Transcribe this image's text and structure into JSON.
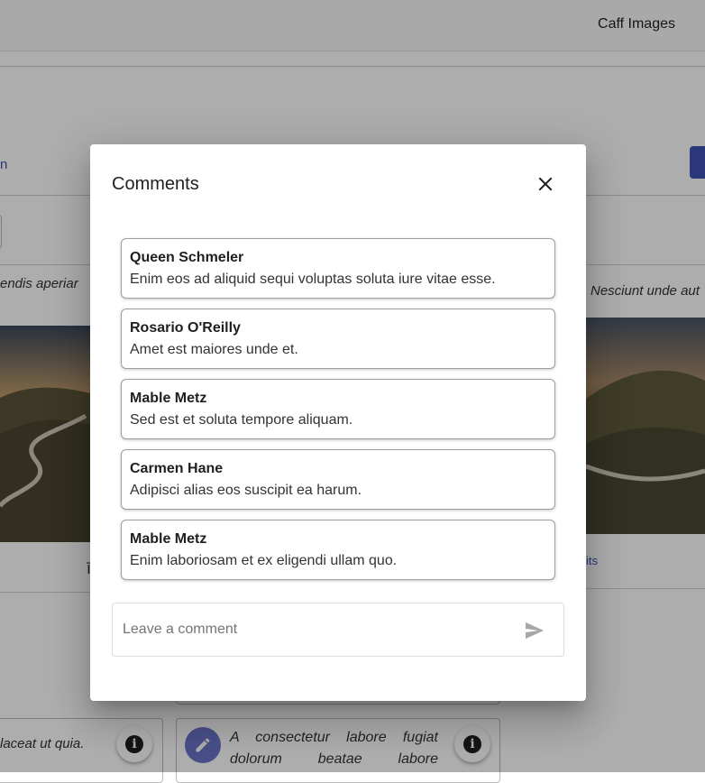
{
  "app": {
    "title": "Caff Images"
  },
  "background": {
    "card_text_left": "endis aperiar",
    "card_text_right": "Nesciunt unde aut",
    "link_fragment_left": "n",
    "link_fragment_right": "its",
    "char_fragment": "ī",
    "bottom_card_left_text": "laceat ut quia.",
    "bottom_card_mid_text": "A consectetur labore fugiat dolorum beatae labore",
    "icons": {
      "info": "info-icon",
      "edit": "pencil-icon"
    }
  },
  "dialog": {
    "title": "Comments",
    "close_icon": "close-icon",
    "comments": [
      {
        "author": "Queen Schmeler",
        "text": "Enim eos ad aliquid sequi voluptas soluta iure vitae esse."
      },
      {
        "author": "Rosario O'Reilly",
        "text": "Amet est maiores unde et."
      },
      {
        "author": "Mable Metz",
        "text": "Sed est et soluta tempore aliquam."
      },
      {
        "author": "Carmen Hane",
        "text": "Adipisci alias eos suscipit ea harum."
      },
      {
        "author": "Mable Metz",
        "text": "Enim laboriosam et ex eligendi ullam quo."
      }
    ],
    "input": {
      "placeholder": "Leave a comment",
      "value": ""
    },
    "send_icon": "send-icon"
  },
  "colors": {
    "primary": "#3f51b5",
    "backdrop": "rgba(0,0,0,0.32)",
    "accent_edit": "#6b75c9"
  }
}
